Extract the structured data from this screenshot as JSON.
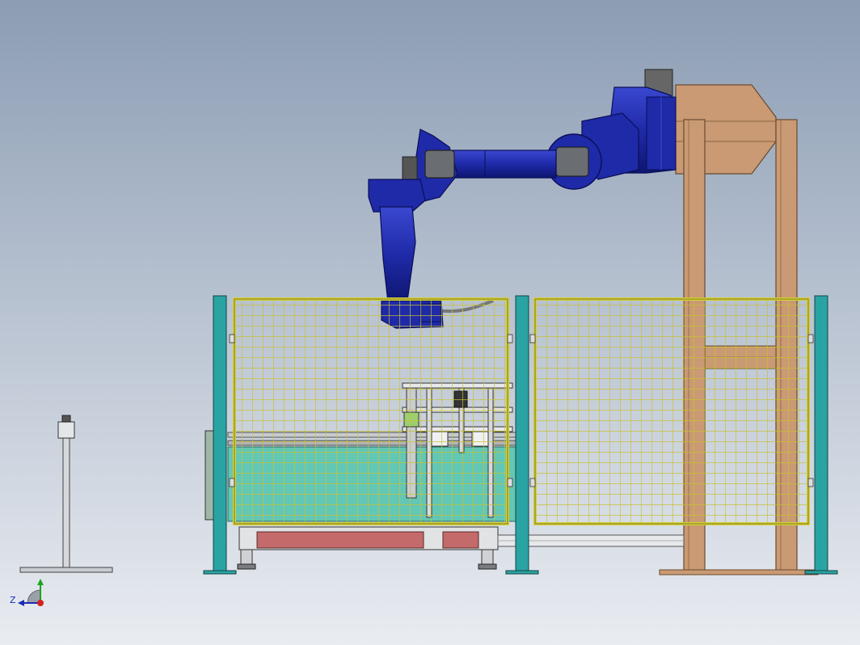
{
  "scene": {
    "background_top": "#8c9db4",
    "background_bottom": "#e9ecf1"
  },
  "colors": {
    "robot_blue": "#1f2aa8",
    "robot_dark": "#0e1670",
    "frame_tan": "#c99a73",
    "frame_tan_dark": "#8a6446",
    "fence_yellow": "#d4cf3a",
    "fence_yellow_dark": "#8f8a1c",
    "post_teal": "#2aa3a3",
    "water_teal": "#63c7b5",
    "rail_red": "#c46a6a",
    "steel_grey": "#b9bcc0"
  },
  "triad": {
    "z_label": "Z",
    "icon": "axis-triad-icon"
  }
}
